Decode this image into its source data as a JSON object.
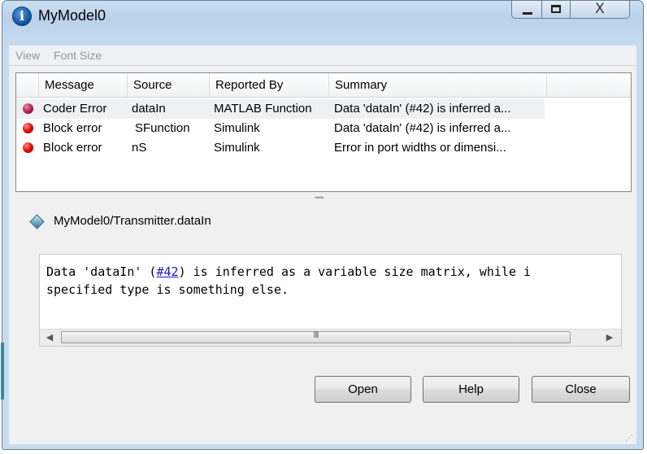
{
  "window": {
    "title": "MyModel0",
    "close_glyph": "X"
  },
  "menu": [
    {
      "label": "View"
    },
    {
      "label": "Font Size"
    }
  ],
  "table": {
    "columns": [
      "Message",
      "Source",
      "Reported By",
      "Summary"
    ],
    "rows": [
      {
        "message": "Coder Error",
        "source": "dataIn",
        "reported_by": "MATLAB Function",
        "summary": "Data 'dataIn' (#42) is inferred a..."
      },
      {
        "message": "Block error",
        "source": "SFunction",
        "reported_by": "Simulink",
        "summary": "Data 'dataIn' (#42) is inferred a..."
      },
      {
        "message": "Block error",
        "source": "nS",
        "reported_by": "Simulink",
        "summary": "Error in port widths or dimensi..."
      }
    ]
  },
  "splitter_grip": "•••••",
  "detail": {
    "path": "MyModel0/Transmitter.dataIn",
    "pre_link": "Data 'dataIn' (",
    "link": "#42",
    "post_link": ") is inferred as a variable size matrix, while i",
    "line2": "specified type is something else.",
    "scroll_grip": "III"
  },
  "buttons": {
    "open": "Open",
    "help": "Help",
    "close": "Close"
  },
  "colors": {
    "accent": "#0e4e9a",
    "error": "#e00000",
    "link": "#1a1acc"
  },
  "icons": [
    "info-icon",
    "minimize-icon",
    "maximize-icon",
    "close-icon",
    "error-icon",
    "block-icon",
    "arrow-left-icon",
    "arrow-right-icon",
    "resize-grip-icon"
  ]
}
